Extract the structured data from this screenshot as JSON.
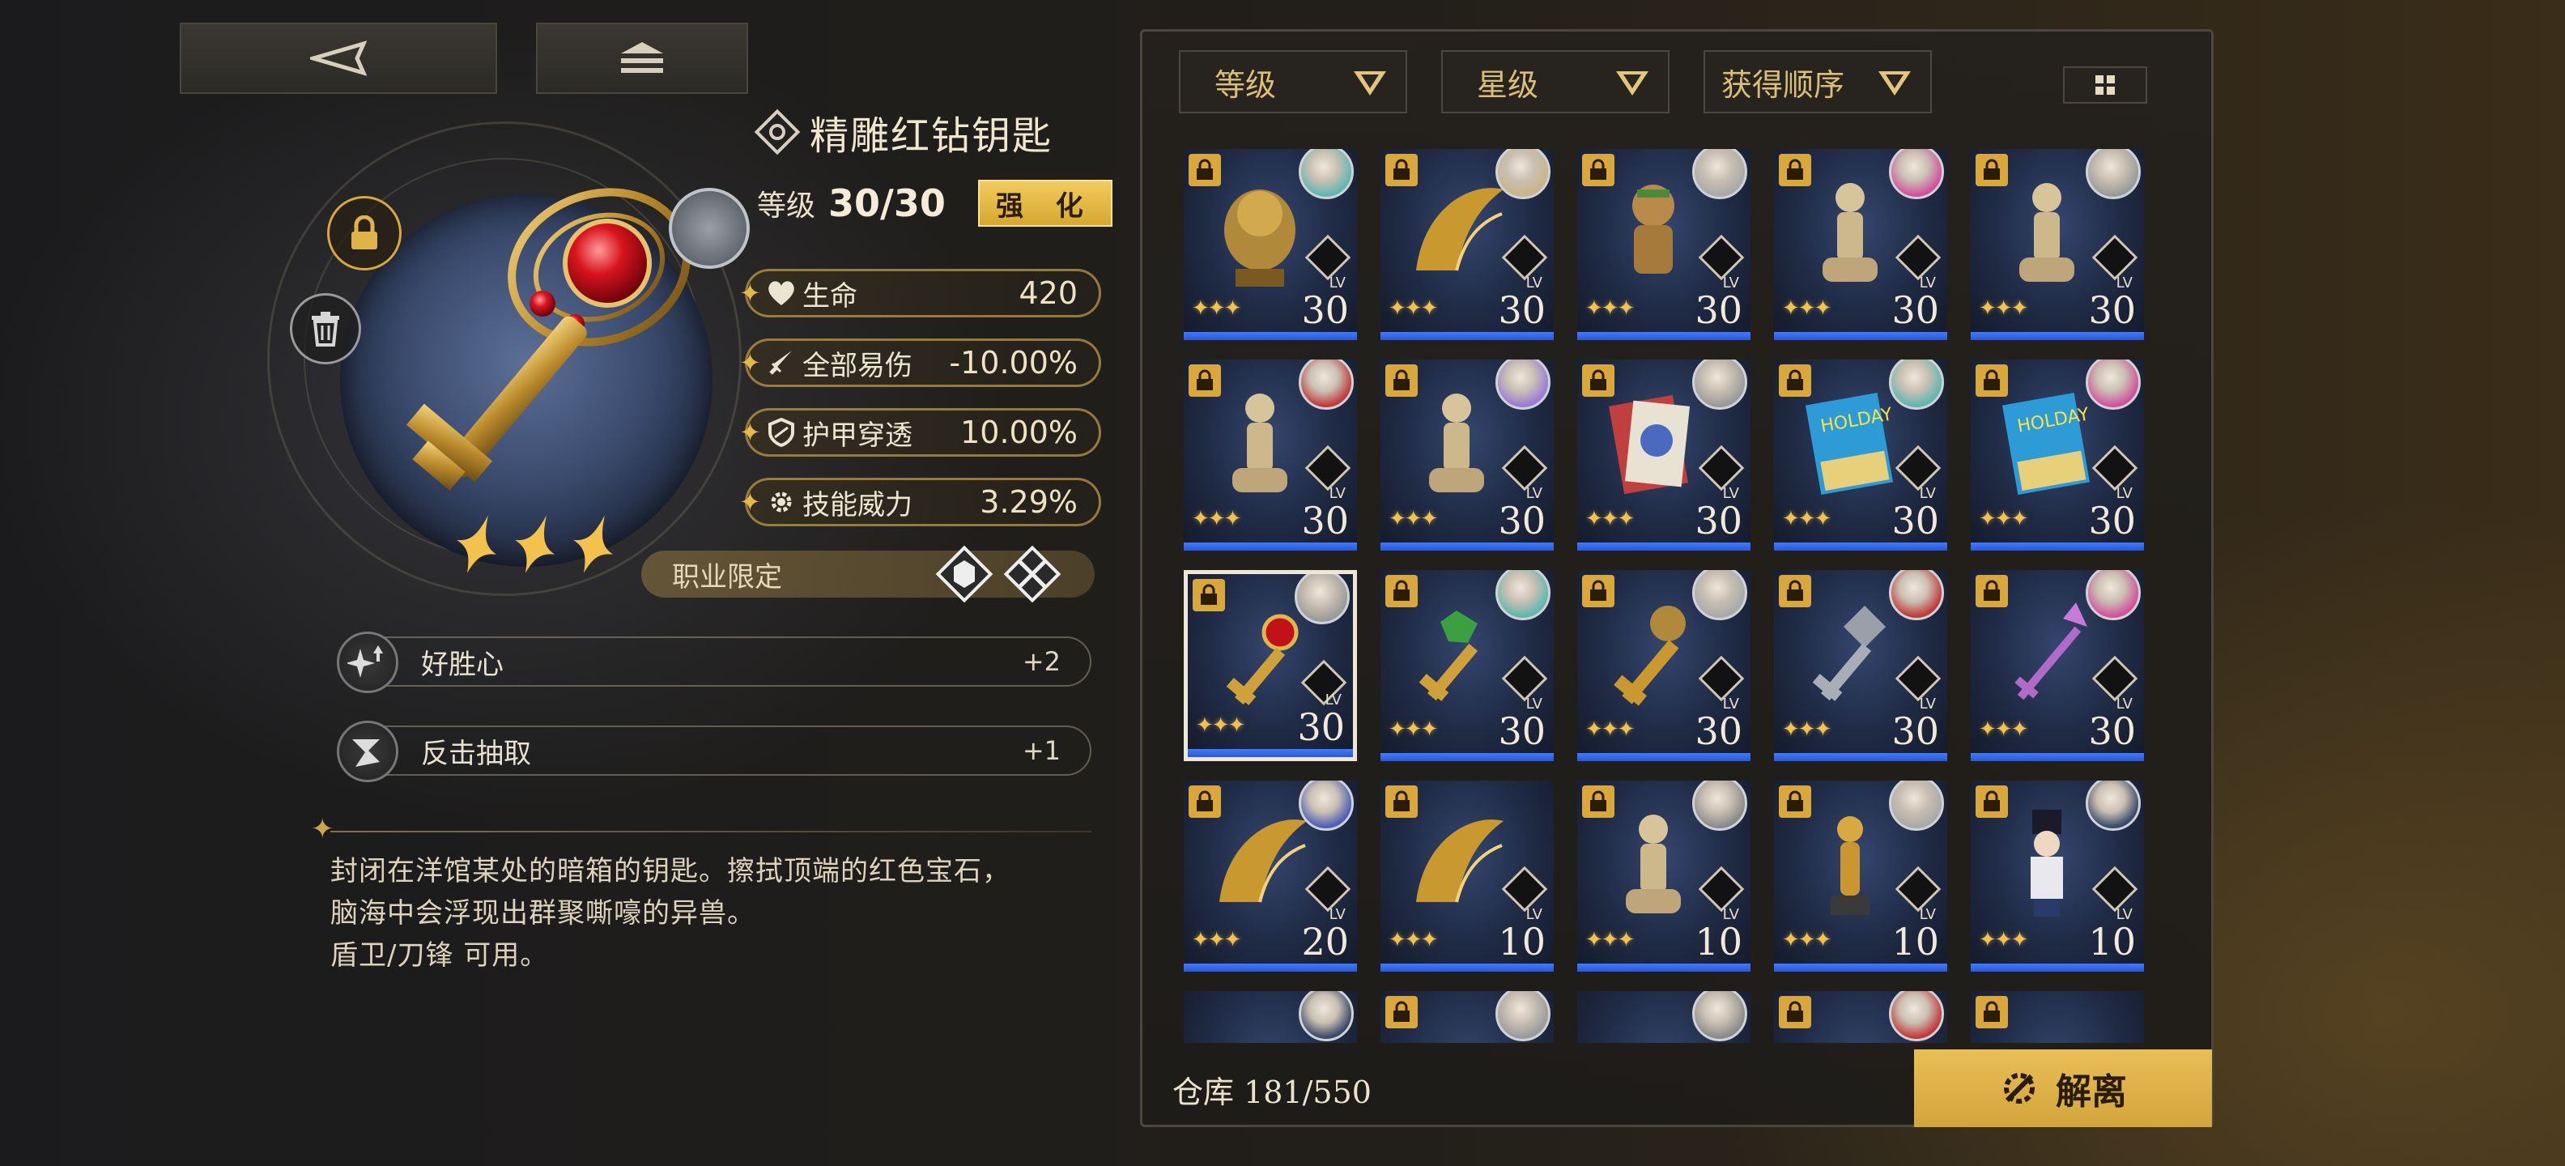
{
  "nav": {
    "back_icon": "back-arrow-icon",
    "home_icon": "stack-icon"
  },
  "item": {
    "name": "精雕红钻钥匙",
    "level_label": "等级",
    "level_current": "30",
    "level_sep": "/",
    "level_max": "30",
    "enhance_label": "强 化",
    "stars": 3,
    "stats": [
      {
        "icon": "heart-icon",
        "name": "生命",
        "value": "420"
      },
      {
        "icon": "sword-icon",
        "name": "全部易伤",
        "value": "-10.00%"
      },
      {
        "icon": "shield-icon",
        "name": "护甲穿透",
        "value": "10.00%"
      },
      {
        "icon": "gear-icon",
        "name": "技能威力",
        "value": "3.29%"
      }
    ],
    "job_label": "职业限定",
    "skills": [
      {
        "name": "好胜心",
        "value": "+2"
      },
      {
        "name": "反击抽取",
        "value": "+1"
      }
    ],
    "description": [
      "封闭在洋馆某处的暗箱的钥匙。擦拭顶端的红色宝石，",
      "脑海中会浮现出群聚嘶嚎的异兽。",
      "盾卫/刀锋 可用。"
    ]
  },
  "filters": [
    {
      "label": "等级"
    },
    {
      "label": "星级"
    },
    {
      "label": "获得顺序"
    }
  ],
  "inventory": {
    "lv_tag": "LV",
    "cells": [
      {
        "lvl": "30",
        "locked": true,
        "avatar": "#5fb8b0",
        "obj": "lion"
      },
      {
        "lvl": "30",
        "locked": true,
        "avatar": "#c9b48a",
        "obj": "wing"
      },
      {
        "lvl": "30",
        "locked": true,
        "avatar": "#a9a9a9",
        "obj": "doll"
      },
      {
        "lvl": "30",
        "locked": true,
        "avatar": "#d3509e",
        "obj": "mannequin"
      },
      {
        "lvl": "30",
        "locked": true,
        "avatar": "#9a9a9a",
        "obj": "mannequin"
      },
      {
        "lvl": "30",
        "locked": true,
        "avatar": "#c23a3a",
        "obj": "mannequin"
      },
      {
        "lvl": "30",
        "locked": true,
        "avatar": "#9b7ad8",
        "obj": "mannequin"
      },
      {
        "lvl": "30",
        "locked": true,
        "avatar": "#9a9a9a",
        "obj": "card"
      },
      {
        "lvl": "30",
        "locked": true,
        "avatar": "#5fb8b0",
        "obj": "holiday"
      },
      {
        "lvl": "30",
        "locked": true,
        "avatar": "#d3509e",
        "obj": "holiday"
      },
      {
        "lvl": "30",
        "locked": true,
        "avatar": "#9a9a9a",
        "obj": "redkey",
        "selected": true
      },
      {
        "lvl": "30",
        "locked": true,
        "avatar": "#5fb8b0",
        "obj": "greenkey"
      },
      {
        "lvl": "30",
        "locked": true,
        "avatar": "#a9a9a9",
        "obj": "goldkey"
      },
      {
        "lvl": "30",
        "locked": true,
        "avatar": "#c23a3a",
        "obj": "silverkey"
      },
      {
        "lvl": "30",
        "locked": true,
        "avatar": "#d3509e",
        "obj": "purplekey"
      },
      {
        "lvl": "20",
        "locked": true,
        "avatar": "#4d5fb8",
        "obj": "wing"
      },
      {
        "lvl": "10",
        "locked": true,
        "avatar": null,
        "obj": "wing"
      },
      {
        "lvl": "10",
        "locked": true,
        "avatar": "#8a8a8a",
        "obj": "mannequin"
      },
      {
        "lvl": "10",
        "locked": true,
        "avatar": "#a9a9a9",
        "obj": "oscar"
      },
      {
        "lvl": "10",
        "locked": true,
        "avatar": "#3a4a6a",
        "obj": "nutcracker"
      },
      {
        "lvl": "",
        "locked": false,
        "avatar": "#3a4a6a",
        "obj": "none"
      },
      {
        "lvl": "",
        "locked": true,
        "avatar": "#9a9a9a",
        "obj": "none"
      },
      {
        "lvl": "",
        "locked": false,
        "avatar": "#8a8a8a",
        "obj": "none"
      },
      {
        "lvl": "",
        "locked": true,
        "avatar": "#c23a3a",
        "obj": "none"
      },
      {
        "lvl": "",
        "locked": true,
        "avatar": null,
        "obj": "none"
      }
    ]
  },
  "footer": {
    "warehouse": "仓库 181/550",
    "dismantle_label": "解离"
  },
  "colors": {
    "accent": "#d9a73a",
    "bar": "#3f7bff",
    "panel": "#24211d"
  }
}
